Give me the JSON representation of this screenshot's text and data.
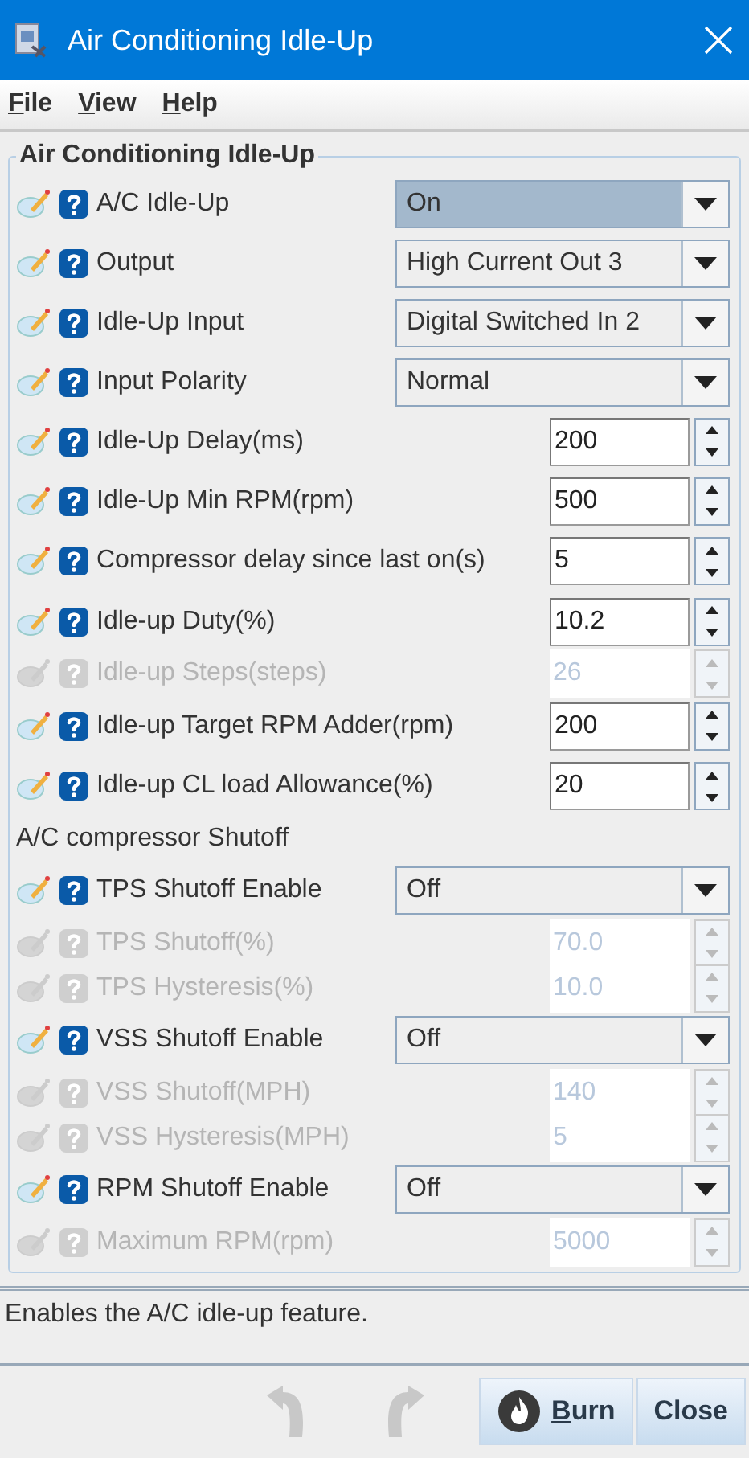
{
  "window": {
    "title": "Air Conditioning Idle-Up"
  },
  "menu": [
    "File",
    "View",
    "Help"
  ],
  "panel": {
    "legend": "Air Conditioning Idle-Up"
  },
  "fields": [
    {
      "kind": "combo",
      "label": "A/C Idle-Up",
      "value": "On",
      "disabled": false,
      "focused": true
    },
    {
      "kind": "combo",
      "label": "Output",
      "value": "High Current Out 3",
      "disabled": false,
      "focused": false
    },
    {
      "kind": "combo",
      "label": "Idle-Up Input",
      "value": "Digital Switched In 2",
      "disabled": false,
      "focused": false
    },
    {
      "kind": "combo",
      "label": "Input Polarity",
      "value": "Normal",
      "disabled": false,
      "focused": false
    },
    {
      "kind": "spinner",
      "label": "Idle-Up Delay(ms)",
      "value": "200",
      "disabled": false,
      "focused": false
    },
    {
      "kind": "spinner",
      "label": "Idle-Up Min RPM(rpm)",
      "value": "500",
      "disabled": false,
      "focused": false
    },
    {
      "kind": "spinner",
      "label": "Compressor delay since last on(s)",
      "value": "5",
      "disabled": false,
      "focused": false
    },
    {
      "kind": "spinner",
      "label": "Idle-up Duty(%)",
      "value": "10.2",
      "disabled": false,
      "focused": false
    },
    {
      "kind": "spinner",
      "label": "Idle-up Steps(steps)",
      "value": "26",
      "disabled": true,
      "focused": false
    },
    {
      "kind": "spinner",
      "label": "Idle-up Target RPM Adder(rpm)",
      "value": "200",
      "disabled": false,
      "focused": false
    },
    {
      "kind": "spinner",
      "label": "Idle-up CL load Allowance(%)",
      "value": "20",
      "disabled": false,
      "focused": false
    },
    {
      "kind": "heading",
      "label": "A/C compressor Shutoff"
    },
    {
      "kind": "combo",
      "label": "TPS Shutoff Enable",
      "value": "Off",
      "disabled": false,
      "focused": false
    },
    {
      "kind": "spinner",
      "label": "TPS Shutoff(%)",
      "value": "70.0",
      "disabled": true,
      "focused": false
    },
    {
      "kind": "spinner",
      "label": "TPS Hysteresis(%)",
      "value": "10.0",
      "disabled": true,
      "focused": false
    },
    {
      "kind": "combo",
      "label": "VSS Shutoff Enable",
      "value": "Off",
      "disabled": false,
      "focused": false
    },
    {
      "kind": "spinner",
      "label": "VSS Shutoff(MPH)",
      "value": "140",
      "disabled": true,
      "focused": false
    },
    {
      "kind": "spinner",
      "label": "VSS Hysteresis(MPH)",
      "value": "5",
      "disabled": true,
      "focused": false
    },
    {
      "kind": "combo",
      "label": "RPM Shutoff Enable",
      "value": "Off",
      "disabled": false,
      "focused": false
    },
    {
      "kind": "spinner",
      "label": "Maximum RPM(rpm)",
      "value": "5000",
      "disabled": true,
      "focused": false
    }
  ],
  "status": "Enables the A/C idle-up feature.",
  "buttons": [
    {
      "kind": "undo",
      "disabled": true
    },
    {
      "kind": "redo",
      "disabled": true
    },
    {
      "kind": "burn",
      "label": "Burn",
      "disabled": false
    },
    {
      "kind": "close",
      "label": "Close",
      "disabled": false
    }
  ]
}
